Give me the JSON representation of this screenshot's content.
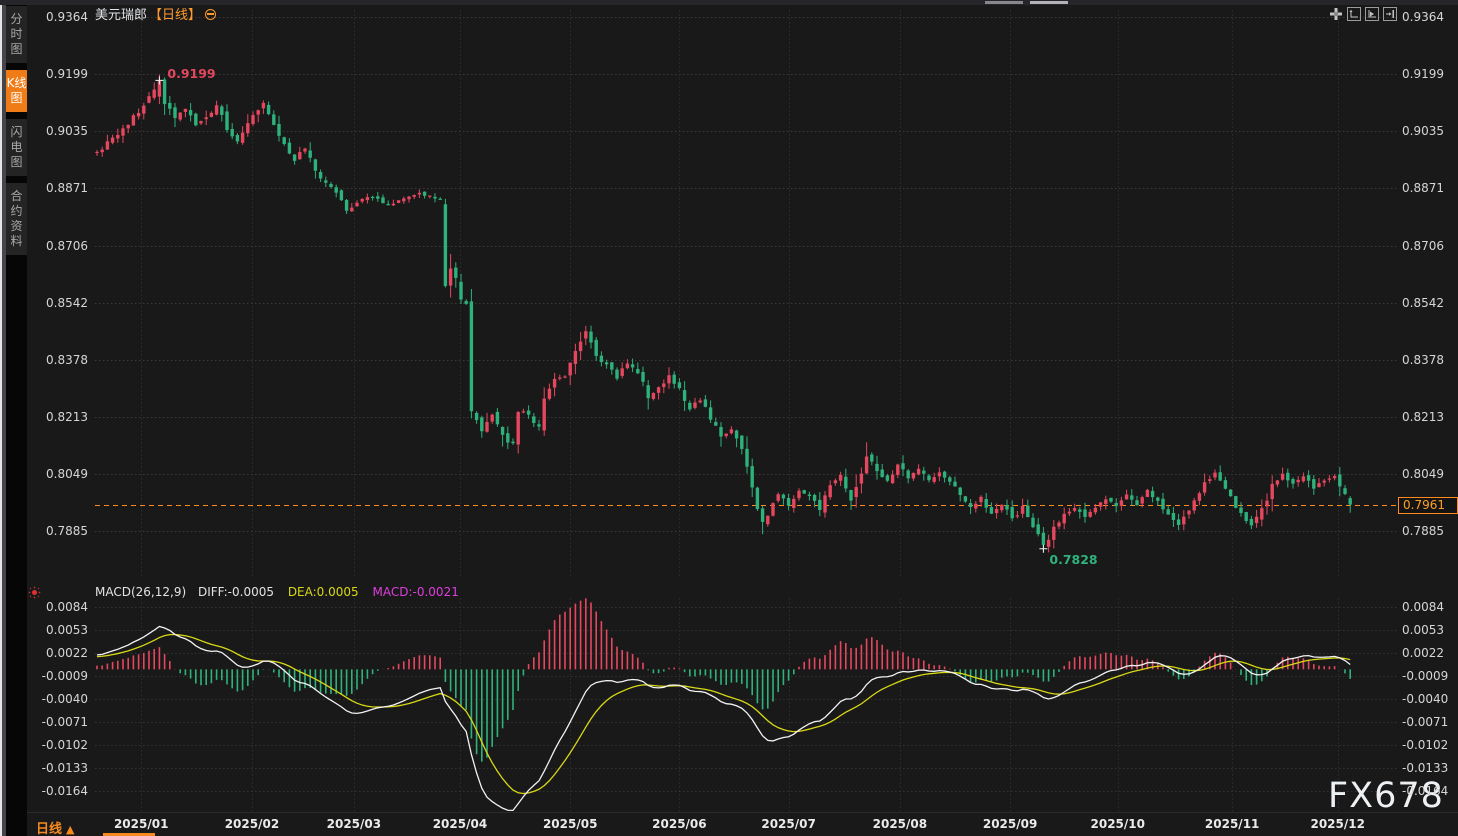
{
  "sidebar": {
    "tabs": [
      {
        "label": "分时图",
        "active": false
      },
      {
        "label": "K线图",
        "active": true
      },
      {
        "label": "闪电图",
        "active": false
      },
      {
        "label": "合约资料",
        "active": false
      }
    ]
  },
  "header": {
    "symbol": "美元瑞郎",
    "timeframe_tag": "【日线】"
  },
  "toolbar": {
    "icons": [
      "crosshair-move-icon",
      "reset-y-axis-icon",
      "auto-scale-icon",
      "scroll-to-latest-icon"
    ]
  },
  "footer": {
    "timeframe_button": "日线",
    "arrow": "▲",
    "watermark": "FX678"
  },
  "colors": {
    "up_red": "#e5475e",
    "down_green": "#2eb27c",
    "accent_orange": "#ff8a1e",
    "diff_white": "#f2f2f2",
    "dea_yellow": "#d8d816",
    "macd_magenta": "#dc3fdc",
    "grid": "#3a3a3a",
    "axis_text": "#d6d6d6",
    "background": "#191919"
  },
  "chart_data": {
    "type": "candlestick",
    "title": "USD/CHF (美元瑞郎) Daily candlestick chart with MACD sub-panel",
    "timeframe": "Daily",
    "legend_position": "top-left",
    "grid": "dotted",
    "price_axis": {
      "ticks": [
        0.9364,
        0.9199,
        0.9035,
        0.8871,
        0.8706,
        0.8542,
        0.8378,
        0.8213,
        0.8049,
        0.7885
      ],
      "range": [
        0.7828,
        0.9364
      ]
    },
    "x_axis": {
      "months": [
        {
          "label": "2025/01",
          "day": 8.5
        },
        {
          "label": "2025/02",
          "day": 29.8
        },
        {
          "label": "2025/03",
          "day": 49.4
        },
        {
          "label": "2025/04",
          "day": 69.8
        },
        {
          "label": "2025/05",
          "day": 91
        },
        {
          "label": "2025/06",
          "day": 112
        },
        {
          "label": "2025/07",
          "day": 133
        },
        {
          "label": "2025/08",
          "day": 154.4
        },
        {
          "label": "2025/09",
          "day": 175.6
        },
        {
          "label": "2025/10",
          "day": 196.3
        },
        {
          "label": "2025/11",
          "day": 218.3
        },
        {
          "label": "2025/12",
          "day": 238.6
        }
      ],
      "days_total": 250
    },
    "annotations": {
      "high": {
        "day": 12,
        "value": 0.9199,
        "label": "0.9199"
      },
      "low": {
        "day": 182,
        "value": 0.7828,
        "label": "0.7828"
      },
      "last_price": "0.7961",
      "last_price_value": 0.7961
    },
    "price_path": [
      [
        0,
        0.8975
      ],
      [
        2,
        0.9
      ],
      [
        5,
        0.9045
      ],
      [
        8,
        0.909
      ],
      [
        10,
        0.914
      ],
      [
        12,
        0.9175
      ],
      [
        13,
        0.912
      ],
      [
        15,
        0.907
      ],
      [
        17,
        0.91
      ],
      [
        19,
        0.9055
      ],
      [
        21,
        0.908
      ],
      [
        23,
        0.911
      ],
      [
        25,
        0.904
      ],
      [
        27,
        0.901
      ],
      [
        29,
        0.906
      ],
      [
        32,
        0.9125
      ],
      [
        34,
        0.906
      ],
      [
        36,
        0.9
      ],
      [
        38,
        0.8955
      ],
      [
        40,
        0.8985
      ],
      [
        43,
        0.89
      ],
      [
        46,
        0.886
      ],
      [
        48,
        0.8805
      ],
      [
        50,
        0.883
      ],
      [
        53,
        0.885
      ],
      [
        56,
        0.882
      ],
      [
        59,
        0.884
      ],
      [
        62,
        0.8855
      ],
      [
        66,
        0.884
      ],
      [
        67,
        0.859
      ],
      [
        68,
        0.865
      ],
      [
        70,
        0.856
      ],
      [
        71,
        0.854
      ],
      [
        72,
        0.824
      ],
      [
        74,
        0.818
      ],
      [
        76,
        0.8215
      ],
      [
        78,
        0.815
      ],
      [
        80,
        0.8135
      ],
      [
        81,
        0.824
      ],
      [
        83,
        0.822
      ],
      [
        85,
        0.818
      ],
      [
        86,
        0.826
      ],
      [
        88,
        0.832
      ],
      [
        90,
        0.833
      ],
      [
        92,
        0.84
      ],
      [
        94,
        0.846
      ],
      [
        96,
        0.839
      ],
      [
        98,
        0.836
      ],
      [
        100,
        0.833
      ],
      [
        102,
        0.837
      ],
      [
        104,
        0.834
      ],
      [
        106,
        0.827
      ],
      [
        108,
        0.83
      ],
      [
        110,
        0.833
      ],
      [
        112,
        0.829
      ],
      [
        114,
        0.824
      ],
      [
        116,
        0.8265
      ],
      [
        118,
        0.821
      ],
      [
        120,
        0.815
      ],
      [
        122,
        0.818
      ],
      [
        124,
        0.812
      ],
      [
        126,
        0.802
      ],
      [
        128,
        0.79
      ],
      [
        129,
        0.7935
      ],
      [
        131,
        0.799
      ],
      [
        133,
        0.796
      ],
      [
        135,
        0.8
      ],
      [
        137,
        0.7985
      ],
      [
        139,
        0.795
      ],
      [
        141,
        0.801
      ],
      [
        143,
        0.805
      ],
      [
        145,
        0.798
      ],
      [
        147,
        0.806
      ],
      [
        148,
        0.811
      ],
      [
        150,
        0.806
      ],
      [
        152,
        0.803
      ],
      [
        154,
        0.807
      ],
      [
        156,
        0.804
      ],
      [
        158,
        0.806
      ],
      [
        160,
        0.803
      ],
      [
        162,
        0.805
      ],
      [
        164,
        0.803
      ],
      [
        166,
        0.799
      ],
      [
        168,
        0.795
      ],
      [
        170,
        0.798
      ],
      [
        172,
        0.794
      ],
      [
        174,
        0.796
      ],
      [
        176,
        0.792
      ],
      [
        178,
        0.795
      ],
      [
        180,
        0.79
      ],
      [
        182,
        0.784
      ],
      [
        184,
        0.789
      ],
      [
        186,
        0.793
      ],
      [
        188,
        0.795
      ],
      [
        190,
        0.792
      ],
      [
        192,
        0.795
      ],
      [
        194,
        0.798
      ],
      [
        196,
        0.795
      ],
      [
        198,
        0.799
      ],
      [
        200,
        0.796
      ],
      [
        202,
        0.8
      ],
      [
        204,
        0.797
      ],
      [
        206,
        0.793
      ],
      [
        208,
        0.79
      ],
      [
        210,
        0.795
      ],
      [
        212,
        0.8
      ],
      [
        214,
        0.804
      ],
      [
        215,
        0.8055
      ],
      [
        217,
        0.801
      ],
      [
        219,
        0.796
      ],
      [
        221,
        0.792
      ],
      [
        222,
        0.7895
      ],
      [
        224,
        0.795
      ],
      [
        226,
        0.801
      ],
      [
        228,
        0.8045
      ],
      [
        230,
        0.802
      ],
      [
        232,
        0.804
      ],
      [
        234,
        0.801
      ],
      [
        236,
        0.803
      ],
      [
        238,
        0.804
      ],
      [
        240,
        0.799
      ],
      [
        241,
        0.7961
      ]
    ],
    "macd": {
      "name_label": "MACD(26,12,9)",
      "diff_label": "DIFF:-0.0005",
      "dea_label": "DEA:0.0005",
      "macd_label": "MACD:-0.0021",
      "params": [
        26,
        12,
        9
      ],
      "diff": -0.0005,
      "dea": 0.0005,
      "macd": -0.0021,
      "ticks": [
        0.0084,
        0.0053,
        0.0022,
        -0.0009,
        -0.004,
        -0.0071,
        -0.0102,
        -0.0133,
        -0.0164
      ]
    }
  }
}
